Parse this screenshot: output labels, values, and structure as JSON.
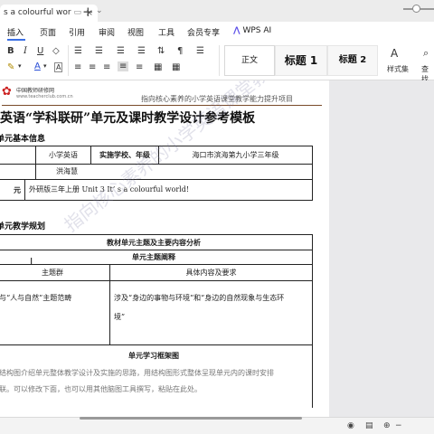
{
  "tab": {
    "title": "s a colourful wor",
    "close_glyph": "×"
  },
  "newtab": {
    "plus": "+",
    "chevron": "⌄"
  },
  "menu": {
    "items": [
      "插入",
      "页面",
      "引用",
      "审阅",
      "视图",
      "工具",
      "会员专享"
    ],
    "wps_ai": "WPS AI"
  },
  "styles": {
    "normal": "正文",
    "h1": "标题 1",
    "h2": "标题 2",
    "styles_label": "样式集",
    "find_label": "查找"
  },
  "doc": {
    "logo_name": "中国教师研修网",
    "logo_url": "www.teacherclub.com.cn",
    "header_text": "指向核心素养的小学英语课堂教学能力提升项目",
    "title": "英语“学科联研”单元及课时教学设计参考模板",
    "section1": "单元基本信息",
    "basic_table": {
      "r1": [
        "小学英语",
        "实施学校、年级",
        "海口市滨海第九小学三年级"
      ],
      "r2_name": "洪海慧",
      "r3_label": "元",
      "r3_value": "外研版三年上册 Unit 3 It’ s a colourful world!"
    },
    "section2": "单元教学规划",
    "plan_table": {
      "row1": "教材单元主题及主要内容分析",
      "row2": "单元主题阐释",
      "col1": "主题群",
      "col2": "具体内容及要求",
      "theme": "”与“人与自然”主题范畴",
      "content_line1": "涉及“身边的事物与环境”和“身边的自然现象与生态环",
      "content_line2": "境”",
      "diagram_title": "单元学习框架图",
      "hint_line1": "结构图介绍单元整体教学设计及实施的思路，用结构图形式整体呈现单元内的课时安排",
      "hint_line2": "联。可以修改下面，也可以用其他脑图工具撰写，粘贴在此处。"
    },
    "watermark": "指向核心素养的小学英语课堂教学能力提升项目"
  },
  "colors": {
    "accent": "#3a6fe4",
    "wps_ai": "#5b4ee8",
    "header_rule": "#7a4a2a"
  },
  "icons": [
    "tab-monitor-icon",
    "bold-icon",
    "italic-icon",
    "underline-icon",
    "eraser-icon",
    "list-icon",
    "align-icon",
    "highlight-icon",
    "font-color-icon",
    "cursor-icon",
    "zoom-slider-icon"
  ]
}
